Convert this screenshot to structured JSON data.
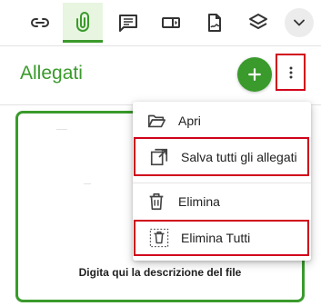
{
  "toolbar": {
    "icons": [
      "link-icon",
      "paperclip-icon",
      "comment-icon",
      "toggle-card-icon",
      "signed-document-icon",
      "layers-icon",
      "chevron-down-icon"
    ],
    "active": "paperclip-icon"
  },
  "header": {
    "title": "Allegati",
    "add_icon": "plus-icon",
    "menu_icon": "kebab-icon"
  },
  "attachment": {
    "caption": "Digita qui la descrizione del file"
  },
  "menu": {
    "items": [
      {
        "label": "Apri",
        "icon": "folder-open-icon"
      },
      {
        "label": "Salva tutti gli allegati",
        "icon": "save-all-icon"
      },
      {
        "label": "Elimina",
        "icon": "trash-icon"
      },
      {
        "label": "Elimina Tutti",
        "icon": "trash-all-icon"
      }
    ]
  },
  "colors": {
    "accent": "#3a9a2c",
    "highlight": "#d0021b",
    "active_bg": "#e8f5e0"
  }
}
